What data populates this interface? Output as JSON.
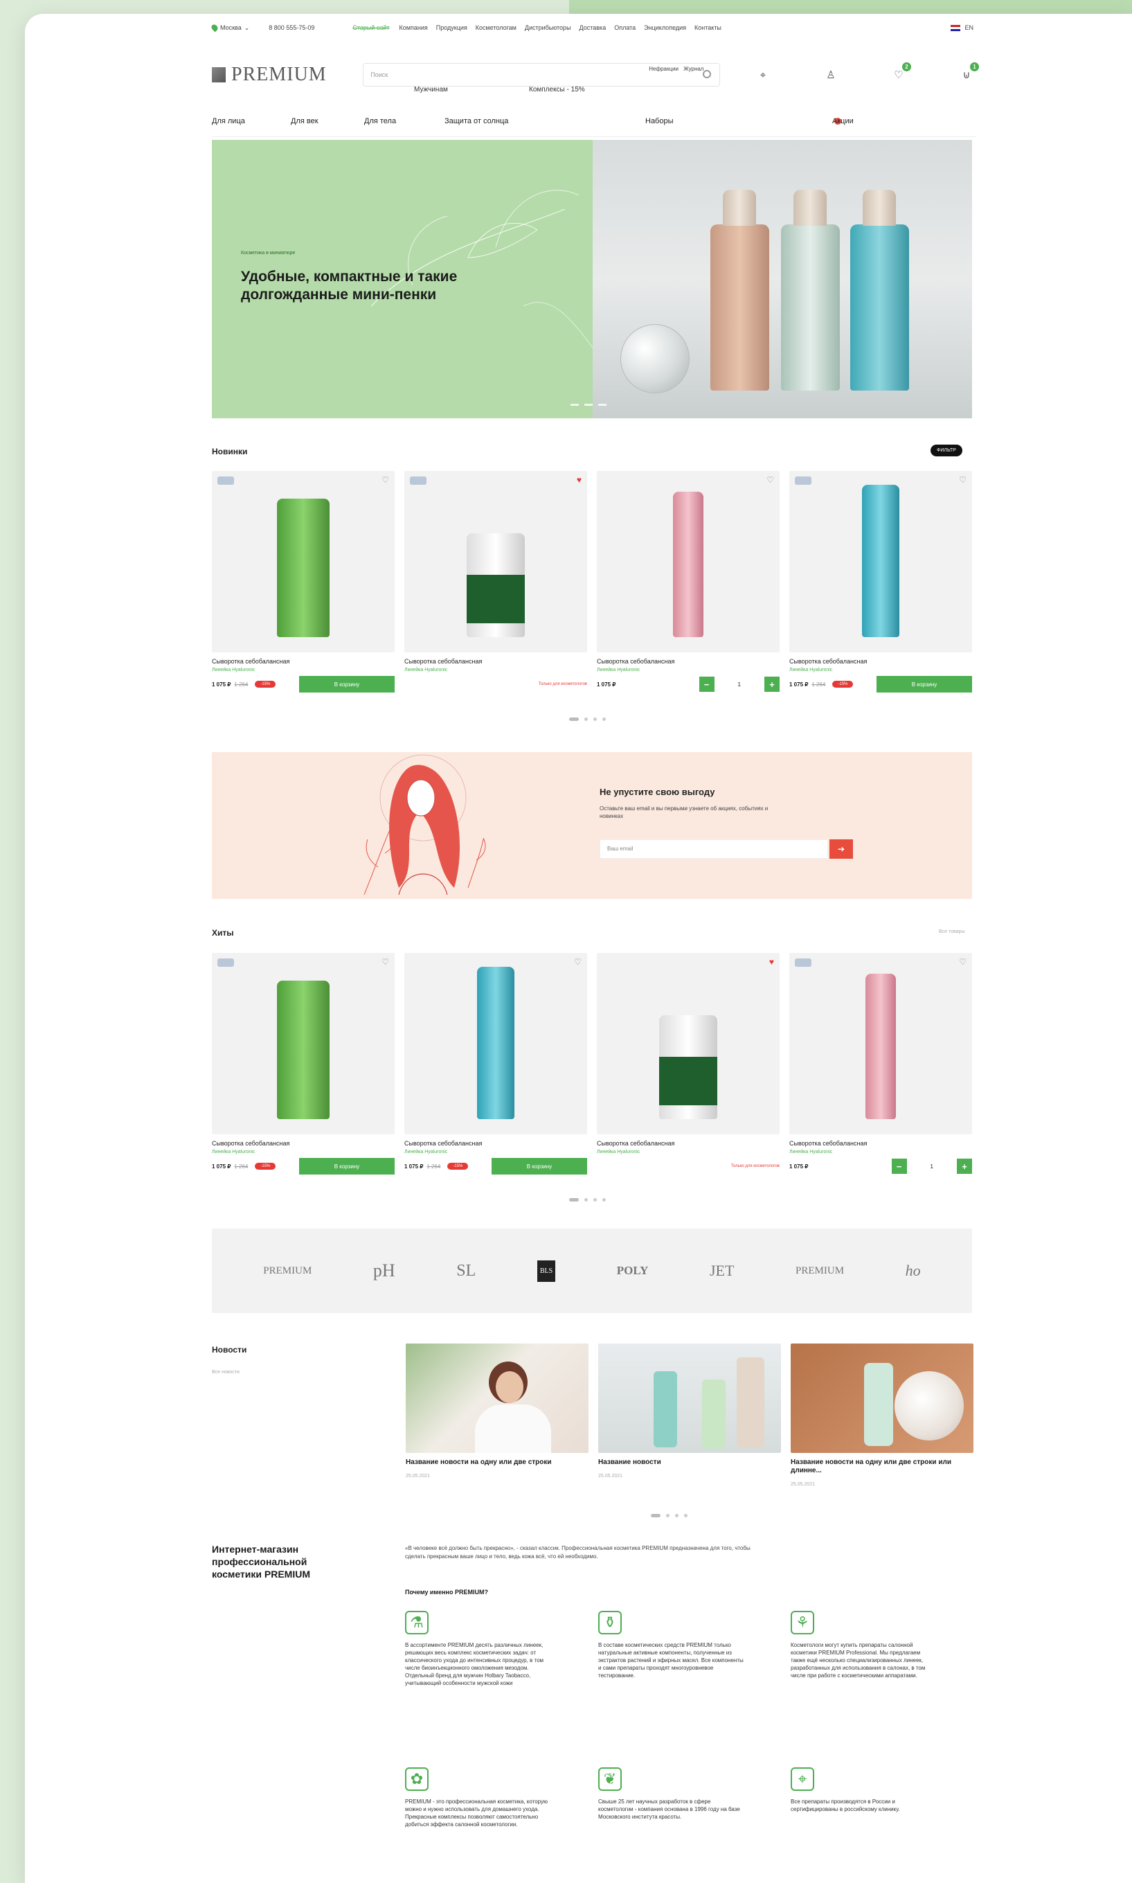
{
  "topbar": {
    "city": "Москва",
    "phone": "8 800 555-75-09",
    "old_site": "Старый сайт",
    "nav": [
      "Компания",
      "Продукция",
      "Косметологам",
      "Дистрибьюторы",
      "Доставка",
      "Оплата",
      "Энциклопедия",
      "Контакты"
    ],
    "lang": "EN"
  },
  "header": {
    "logo": "PREMIUM",
    "search_placeholder": "Поиск",
    "search_chip_1": "Нефракции",
    "search_chip_2": "Журнал",
    "sub_1": "Мужчинам",
    "sub_2": "Комплексы - 15%",
    "wishlist_count": "2",
    "cart_count": "1"
  },
  "nav": {
    "items": [
      "Для лица",
      "Для век",
      "Для тела",
      "Защита от солнца",
      "Наборы",
      "Акции"
    ]
  },
  "hero": {
    "kicker": "Косметика в миниатюре",
    "title": "Удобные, компактные и такие долгожданные мини-пенки"
  },
  "new": {
    "title": "Новинки",
    "filter": "ФИЛЬТР",
    "products": [
      {
        "name": "Сыворотка себобалансная",
        "line": "Линейка Hyaluronic",
        "price": "1 075 ₽",
        "old": "1 264",
        "disc": "-15%",
        "action": "В корзину",
        "liked": false
      },
      {
        "name": "Сыворотка себобалансная",
        "line": "Линейка Hyaluronic",
        "price": "",
        "old": "",
        "disc": "",
        "action": "Только для косметологов",
        "liked": true
      },
      {
        "name": "Сыворотка себобалансная",
        "line": "Линейка Hyaluronic",
        "price": "1 075 ₽",
        "old": "",
        "disc": "",
        "action": "stepper",
        "qty": "1",
        "liked": false
      },
      {
        "name": "Сыворотка себобалансная",
        "line": "Линейка Hyaluronic",
        "price": "1 075 ₽",
        "old": "1 264",
        "disc": "-15%",
        "action": "В корзину",
        "liked": false
      }
    ]
  },
  "subscribe": {
    "title": "Не упустите свою выгоду",
    "text": "Оставьте ваш email и вы первыми узнаете об акциях, событиях и новинках",
    "placeholder": "Ваш email",
    "send": "➔"
  },
  "hits": {
    "title": "Хиты",
    "all": "Все товары",
    "products": [
      {
        "name": "Сыворотка себобалансная",
        "line": "Линейка Hyaluronic",
        "price": "1 075 ₽",
        "old": "1 264",
        "disc": "-15%",
        "action": "В корзину",
        "liked": false
      },
      {
        "name": "Сыворотка себобалансная",
        "line": "Линейка Hyaluronic",
        "price": "1 075 ₽",
        "old": "1 264",
        "disc": "-15%",
        "action": "В корзину",
        "liked": false
      },
      {
        "name": "Сыворотка себобалансная",
        "line": "Линейка Hyaluronic",
        "price": "",
        "old": "",
        "disc": "",
        "action": "Только для косметологов",
        "liked": true
      },
      {
        "name": "Сыворотка себобалансная",
        "line": "Линейка Hyaluronic",
        "price": "1 075 ₽",
        "old": "",
        "disc": "",
        "action": "stepper",
        "qty": "1",
        "liked": false
      }
    ]
  },
  "brands": [
    "PREMIUM",
    "pH",
    "SL",
    "BLS",
    "POLY",
    "JET",
    "PREMIUM",
    "ho"
  ],
  "news": {
    "title": "Новости",
    "all": "Все новости",
    "items": [
      {
        "title": "Название новости на одну или две строки",
        "date": "25.05.2021"
      },
      {
        "title": "Название новости",
        "date": "25.05.2021"
      },
      {
        "title": "Название новости на одну или две строки или длинне...",
        "date": "25.05.2021"
      }
    ]
  },
  "about": {
    "title": "Интернет-магазин профессиональной косметики PREMIUM",
    "text": "«В человеке всё должно быть прекрасно», - сказал классик. Профессиональная косметика PREMIUM предназначена для того, чтобы сделать прекрасным ваше лицо и тело, ведь кожа всё, что ей необходимо.",
    "why": "Почему именно PREMIUM?",
    "features": [
      "В ассортименте PREMIUM десять различных линеек, решающих весь комплекс косметических задач: от классического ухода до интенсивных процедур, в том числе биоинъекционного омоложения мезодом. Отдельный бренд для мужчин Holbary Taobacco, учитывающий особенности мужской кожи",
      "В составе косметических средств PREMIUM только натуральные активные компоненты, полученные из экстрактов растений и эфирных масел. Все компоненты и сами препараты проходят многоуровневое тестирование.",
      "Косметологи могут купить препараты салонной косметики PREMIUM Professional. Мы предлагаем также ещё несколько специализированных линеек, разработанных для использования в салонах, в том числе при работе с косметическими аппаратами.",
      "PREMIUM - это профессиональная косметика, которую можно и нужно использовать для домашнего ухода. Прекрасные комплексы позволяют самостоятельно добиться эффекта салонной косметологии.",
      "Свыше 25 лет научных разработок в сфере косметологии - компания основана в 1996 году на базе Московского института красоты.",
      "Все препараты производятся в России и сертифицированы в российскому клинику."
    ]
  },
  "colors": {
    "accent": "#4caf50",
    "sale": "#e53935",
    "hero_bg": "#b4dba9",
    "subscribe_bg": "#fbe9df"
  }
}
